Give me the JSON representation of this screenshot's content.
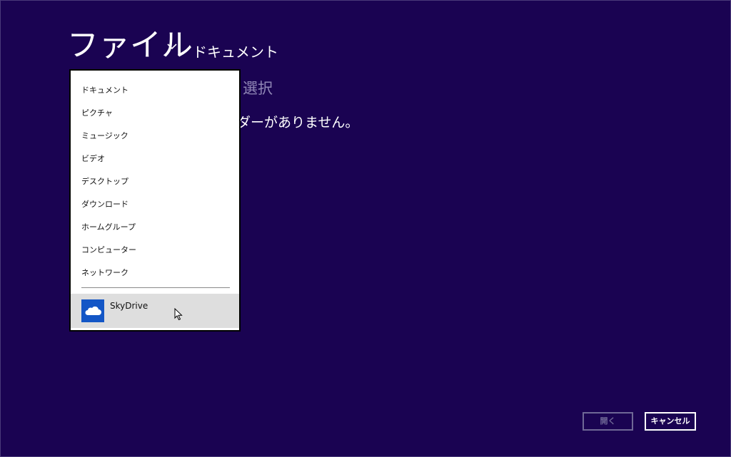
{
  "header": {
    "title": "ファイル",
    "location": "ドキュメント",
    "chevron_icon": "chevron-down-icon"
  },
  "main": {
    "select_text": "選択",
    "empty_message": "ダーがありません。"
  },
  "flyout": {
    "items": [
      {
        "label": "ドキュメント"
      },
      {
        "label": "ピクチャ"
      },
      {
        "label": "ミュージック"
      },
      {
        "label": "ビデオ"
      },
      {
        "label": "デスクトップ"
      },
      {
        "label": "ダウンロード"
      },
      {
        "label": "ホームグループ"
      },
      {
        "label": "コンピューター"
      },
      {
        "label": "ネットワーク"
      }
    ],
    "skydrive": {
      "label": "SkyDrive",
      "icon": "cloud-icon",
      "tile_color": "#1356c6"
    }
  },
  "buttons": {
    "open_label": "開く",
    "cancel_label": "キャンセル"
  },
  "colors": {
    "background": "#1a0352",
    "flyout_bg": "#ffffff",
    "selected_bg": "#dedede"
  }
}
